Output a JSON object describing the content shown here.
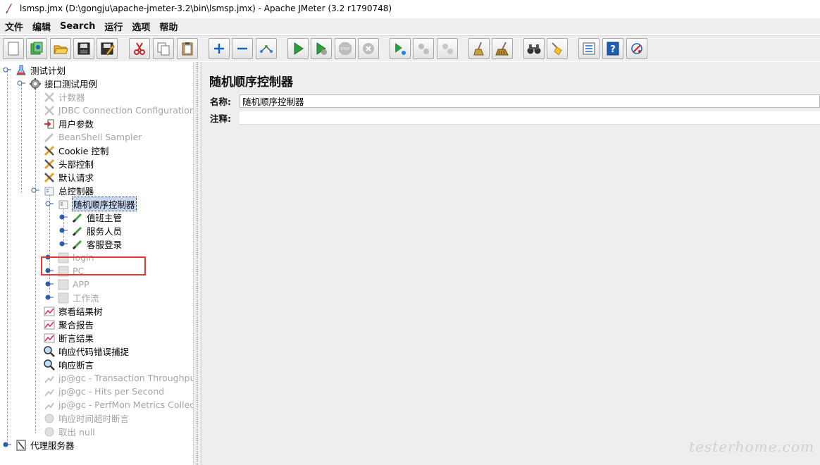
{
  "window": {
    "title": "lsmsp.jmx (D:\\gongju\\apache-jmeter-3.2\\bin\\lsmsp.jmx) - Apache JMeter (3.2 r1790748)"
  },
  "menu": [
    "文件",
    "编辑",
    "Search",
    "运行",
    "选项",
    "帮助"
  ],
  "toolbar": {
    "buttons": [
      "new-icon",
      "templates-icon",
      "open-icon",
      "save-icon",
      "save-as-icon",
      "cut-icon",
      "copy-icon",
      "paste-icon",
      "expand-icon",
      "collapse-icon",
      "toggle-icon",
      "start-icon",
      "start-no-pause-icon",
      "stop-icon",
      "shutdown-icon",
      "remote-start-icon",
      "remote-stop-icon",
      "remote-shutdown-icon",
      "clear-icon",
      "clear-all-icon",
      "search-icon",
      "reset-search-icon",
      "function-helper-icon",
      "help-icon",
      "logger-icon"
    ]
  },
  "tree": [
    {
      "label": "测试计划",
      "icon": "test-plan-icon",
      "enabled": true
    },
    {
      "label": "接口测试用例",
      "icon": "thread-group-icon",
      "enabled": true
    },
    {
      "label": "计数器",
      "icon": "config-icon",
      "enabled": false
    },
    {
      "label": "JDBC Connection Configuration",
      "icon": "config-icon",
      "enabled": false
    },
    {
      "label": "用户参数",
      "icon": "preprocessor-icon",
      "enabled": true
    },
    {
      "label": "BeanShell Sampler",
      "icon": "sampler-icon",
      "enabled": false
    },
    {
      "label": "Cookie 控制",
      "icon": "config-icon",
      "enabled": true
    },
    {
      "label": "头部控制",
      "icon": "config-icon",
      "enabled": true
    },
    {
      "label": "默认请求",
      "icon": "config-icon",
      "enabled": true
    },
    {
      "label": "总控制器",
      "icon": "controller-icon",
      "enabled": true
    },
    {
      "label": "随机顺序控制器",
      "icon": "controller-icon",
      "enabled": true,
      "selected": true
    },
    {
      "label": "值班主管",
      "icon": "sampler-icon",
      "enabled": true
    },
    {
      "label": "服务人员",
      "icon": "sampler-icon",
      "enabled": true
    },
    {
      "label": "客服登录",
      "icon": "sampler-icon",
      "enabled": true
    },
    {
      "label": "login",
      "icon": "controller-icon",
      "enabled": false
    },
    {
      "label": "PC",
      "icon": "controller-icon",
      "enabled": false
    },
    {
      "label": "APP",
      "icon": "controller-icon",
      "enabled": false
    },
    {
      "label": "工作流",
      "icon": "controller-icon",
      "enabled": false
    },
    {
      "label": "察看结果树",
      "icon": "listener-icon",
      "enabled": true
    },
    {
      "label": "聚合报告",
      "icon": "listener-icon",
      "enabled": true
    },
    {
      "label": "断言结果",
      "icon": "listener-icon",
      "enabled": true
    },
    {
      "label": "响应代码错误捕捉",
      "icon": "assertion-icon",
      "enabled": true
    },
    {
      "label": "响应断言",
      "icon": "assertion-icon",
      "enabled": true
    },
    {
      "label": "jp@gc - Transaction Throughput vs",
      "icon": "listener-icon",
      "enabled": false
    },
    {
      "label": "jp@gc - Hits per Second",
      "icon": "listener-icon",
      "enabled": false
    },
    {
      "label": "jp@gc - PerfMon Metrics Collector",
      "icon": "listener-icon",
      "enabled": false
    },
    {
      "label": "响应时间超时断言",
      "icon": "assertion-icon",
      "enabled": false
    },
    {
      "label": "取出 null",
      "icon": "postprocessor-icon",
      "enabled": false
    },
    {
      "label": "代理服务器",
      "icon": "workbench-icon",
      "enabled": true
    }
  ],
  "panel": {
    "title": "随机顺序控制器",
    "name_label": "名称:",
    "name_value": "随机顺序控制器",
    "comment_label": "注释:",
    "comment_value": ""
  },
  "watermark": "testerhome.com",
  "colors": {
    "selection_bg": "#c8d8f0",
    "highlight_box": "#e53935",
    "disabled_text": "#a4a4a4",
    "panel_bg": "#eeeeee"
  }
}
